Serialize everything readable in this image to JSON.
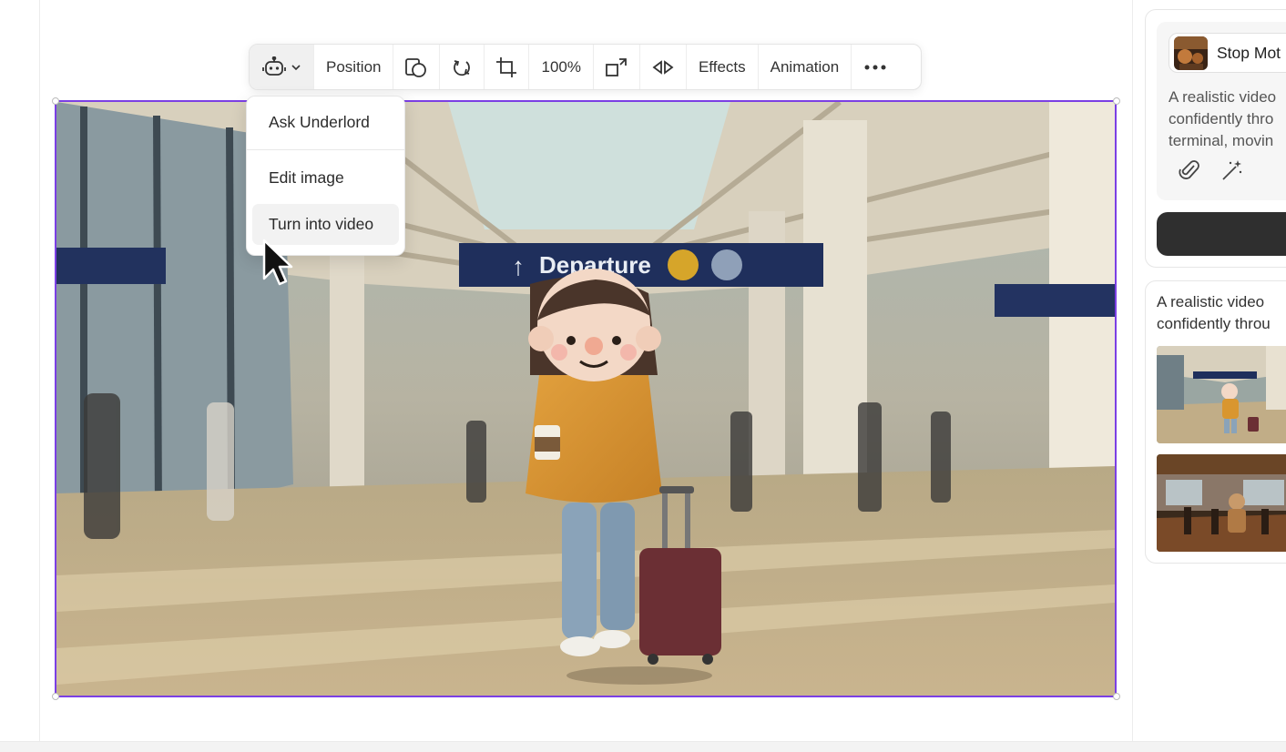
{
  "toolbar": {
    "robot_icon": "robot-icon",
    "position_label": "Position",
    "zoom_label": "100%",
    "effects_label": "Effects",
    "animation_label": "Animation",
    "more_icon": "more-horizontal-icon"
  },
  "menu": {
    "items": [
      {
        "label": "Ask Underlord"
      },
      {
        "label": "Edit image"
      },
      {
        "label": "Turn into video"
      }
    ]
  },
  "canvas": {
    "sign_text": "Departure",
    "selection_color": "#7b3fe4"
  },
  "right_panel": {
    "style_chip_label": "Stop Mot",
    "prompt_lines": [
      "A realistic video",
      "confidently thro",
      "terminal, movin"
    ],
    "result_lines": [
      "A realistic video",
      "confidently throu"
    ]
  }
}
